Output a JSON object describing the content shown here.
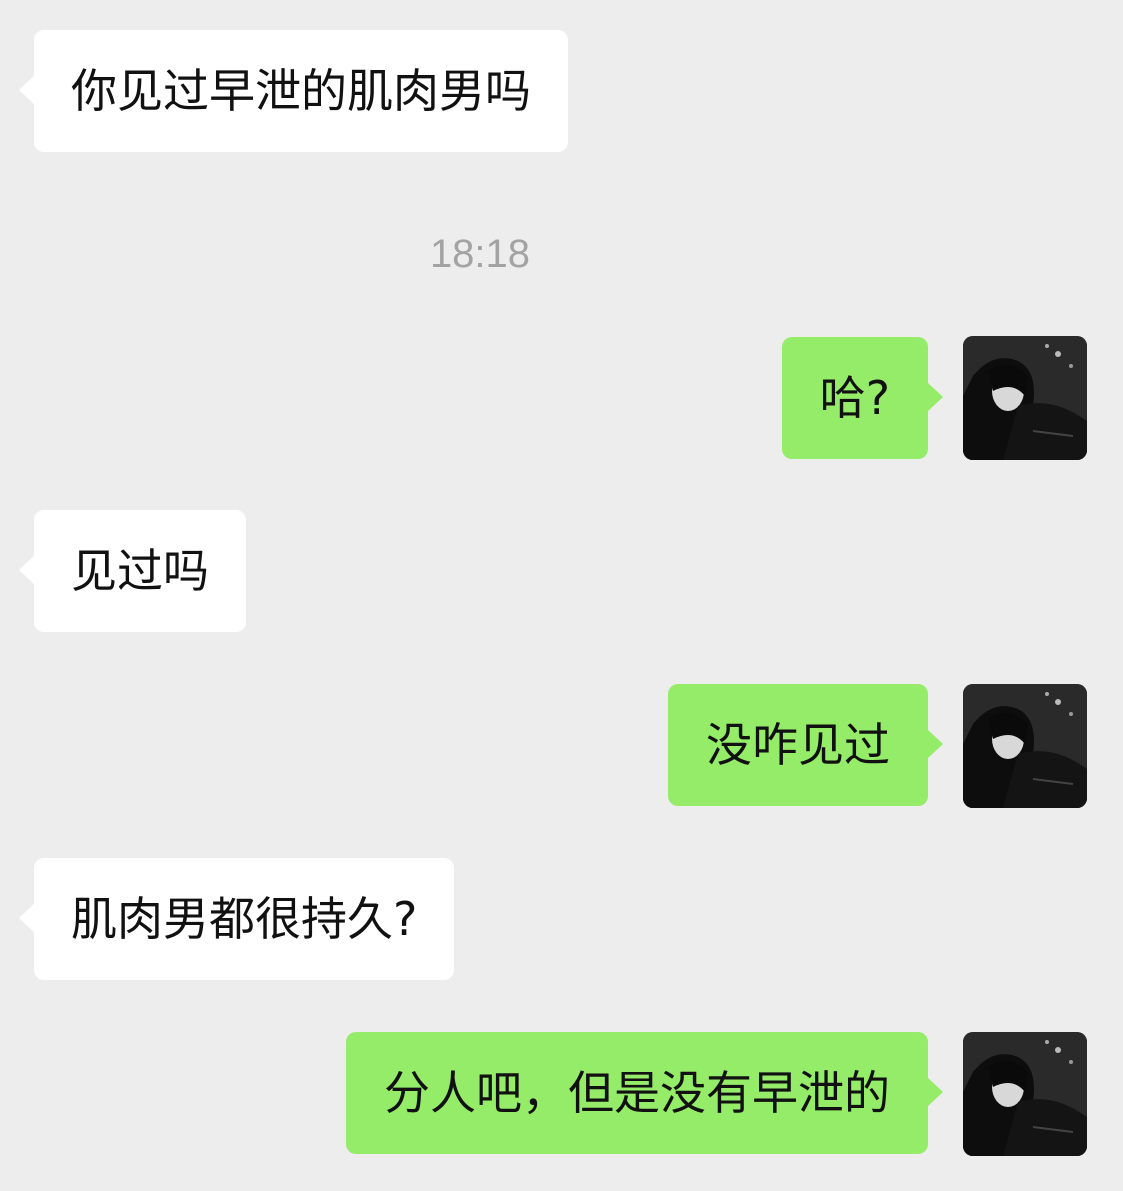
{
  "chat": {
    "timestamp": "18:18",
    "messages": [
      {
        "direction": "incoming",
        "text": "你见过早泄的肌肉男吗"
      },
      {
        "direction": "outgoing",
        "text": "哈?"
      },
      {
        "direction": "incoming",
        "text": "见过吗"
      },
      {
        "direction": "outgoing",
        "text": "没咋见过"
      },
      {
        "direction": "incoming",
        "text": "肌肉男都很持久?"
      },
      {
        "direction": "outgoing",
        "text": "分人吧，但是没有早泄的"
      }
    ]
  },
  "colors": {
    "background": "#ededed",
    "incoming_bubble": "#ffffff",
    "outgoing_bubble": "#95ec69",
    "timestamp_text": "#a3a3a3"
  },
  "icons": {
    "avatar": "user-avatar-photo"
  }
}
